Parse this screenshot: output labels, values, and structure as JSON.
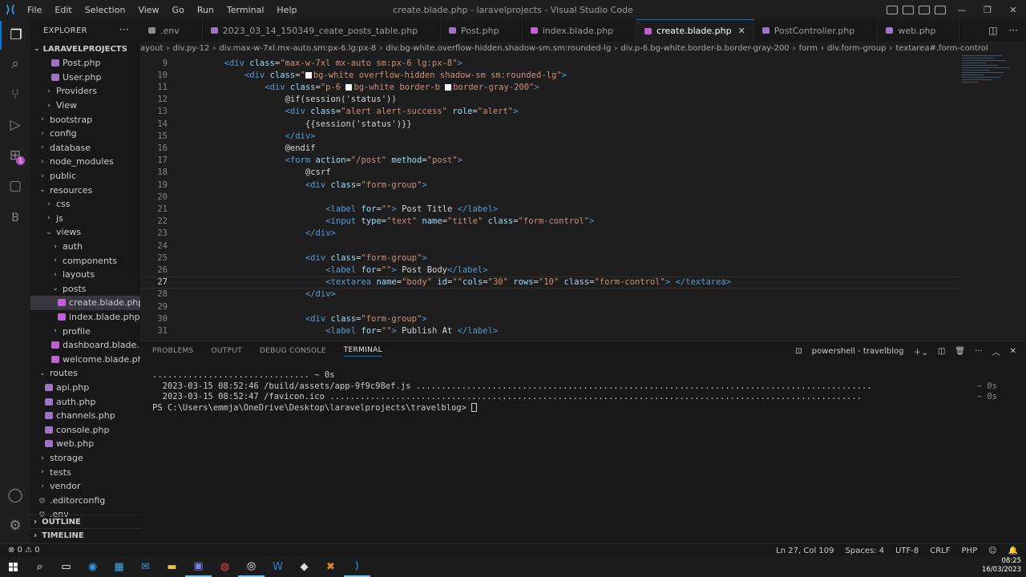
{
  "titlebar": {
    "menu": [
      "File",
      "Edit",
      "Selection",
      "View",
      "Go",
      "Run",
      "Terminal",
      "Help"
    ],
    "title": "create.blade.php - laravelprojects - Visual Studio Code"
  },
  "sidebar": {
    "header": "EXPLORER",
    "project": "LARAVELPROJECTS",
    "items": [
      {
        "label": "Post.php",
        "kind": "php",
        "indent": 3
      },
      {
        "label": "User.php",
        "kind": "php",
        "indent": 3
      },
      {
        "label": "Providers",
        "kind": "folder",
        "indent": 2
      },
      {
        "label": "View",
        "kind": "folder",
        "indent": 2
      },
      {
        "label": "bootstrap",
        "kind": "folder",
        "indent": 1
      },
      {
        "label": "config",
        "kind": "folder",
        "indent": 1
      },
      {
        "label": "database",
        "kind": "folder",
        "indent": 1
      },
      {
        "label": "node_modules",
        "kind": "folder",
        "indent": 1
      },
      {
        "label": "public",
        "kind": "folder",
        "indent": 1
      },
      {
        "label": "resources",
        "kind": "folder-open",
        "indent": 1
      },
      {
        "label": "css",
        "kind": "folder",
        "indent": 2
      },
      {
        "label": "js",
        "kind": "folder",
        "indent": 2
      },
      {
        "label": "views",
        "kind": "folder-open",
        "indent": 2
      },
      {
        "label": "auth",
        "kind": "folder",
        "indent": 3
      },
      {
        "label": "components",
        "kind": "folder",
        "indent": 3
      },
      {
        "label": "layouts",
        "kind": "folder",
        "indent": 3
      },
      {
        "label": "posts",
        "kind": "folder-open",
        "indent": 3
      },
      {
        "label": "create.blade.php",
        "kind": "blade",
        "indent": 4,
        "selected": true
      },
      {
        "label": "index.blade.php",
        "kind": "blade",
        "indent": 4
      },
      {
        "label": "profile",
        "kind": "folder",
        "indent": 3
      },
      {
        "label": "dashboard.blade....",
        "kind": "blade",
        "indent": 3
      },
      {
        "label": "welcome.blade.php",
        "kind": "blade",
        "indent": 3
      },
      {
        "label": "routes",
        "kind": "folder-open",
        "indent": 1
      },
      {
        "label": "api.php",
        "kind": "php",
        "indent": 2
      },
      {
        "label": "auth.php",
        "kind": "php",
        "indent": 2
      },
      {
        "label": "channels.php",
        "kind": "php",
        "indent": 2
      },
      {
        "label": "console.php",
        "kind": "php",
        "indent": 2
      },
      {
        "label": "web.php",
        "kind": "php",
        "indent": 2
      },
      {
        "label": "storage",
        "kind": "folder",
        "indent": 1
      },
      {
        "label": "tests",
        "kind": "folder",
        "indent": 1
      },
      {
        "label": "vendor",
        "kind": "folder",
        "indent": 1
      },
      {
        "label": ".editorconfig",
        "kind": "gear",
        "indent": 1
      },
      {
        "label": ".env",
        "kind": "gear",
        "indent": 1
      }
    ],
    "outline": "OUTLINE",
    "timeline": "TIMELINE"
  },
  "tabs": [
    {
      "label": ".env",
      "color": "#8c8c8c"
    },
    {
      "label": "2023_03_14_150349_ceate_posts_table.php",
      "color": "#a074c4"
    },
    {
      "label": "Post.php",
      "color": "#a074c4"
    },
    {
      "label": "index.blade.php",
      "color": "#c25fd6"
    },
    {
      "label": "create.blade.php",
      "color": "#c25fd6",
      "active": true
    },
    {
      "label": "PostController.php",
      "color": "#a074c4"
    },
    {
      "label": "web.php",
      "color": "#a074c4"
    }
  ],
  "breadcrumb": [
    "ayout",
    "div.py-12",
    "div.max-w-7xl.mx-auto.sm:px-6.lg:px-8",
    "div.bg-white.overflow-hidden.shadow-sm.sm:rounded-lg",
    "div.p-6.bg-white.border-b.border-gray-200",
    "form",
    "div.form-group",
    "textarea#.form-control"
  ],
  "editor": {
    "lines": [
      {
        "n": "9",
        "indent": 4,
        "html": "<span class='tag'>&lt;div</span> <span class='attr'>class</span>=<span class='str'>\"max-w-7xl mx-auto sm:px-6 lg:px-8\"</span><span class='tag'>&gt;</span>"
      },
      {
        "n": "10",
        "indent": 6,
        "html": "<span class='tag'>&lt;div</span> <span class='attr'>class</span>=<span class='str'>\"<i class='sq'></i>bg-white overflow-hidden shadow-sm sm:rounded-lg\"</span><span class='tag'>&gt;</span>"
      },
      {
        "n": "11",
        "indent": 8,
        "html": "<span class='tag'>&lt;div</span> <span class='attr'>class</span>=<span class='str'>\"p-6 <i class='sq'></i>bg-white border-b <i class='sq'></i>border-gray-200\"</span><span class='tag'>&gt;</span>"
      },
      {
        "n": "12",
        "indent": 10,
        "html": "<span class='dir'>@if(session('status'))</span>"
      },
      {
        "n": "13",
        "indent": 10,
        "html": "<span class='tag'>&lt;div</span> <span class='attr'>class</span>=<span class='str'>\"alert alert-success\"</span> <span class='attr'>role</span>=<span class='str'>\"alert\"</span><span class='tag'>&gt;</span>"
      },
      {
        "n": "14",
        "indent": 12,
        "html": "<span class='dir'>{{session('status')}}</span>"
      },
      {
        "n": "15",
        "indent": 10,
        "html": "<span class='tag'>&lt;/div&gt;</span>"
      },
      {
        "n": "16",
        "indent": 10,
        "html": "<span class='dir'>@endif</span>"
      },
      {
        "n": "17",
        "indent": 10,
        "html": "<span class='tag'>&lt;form</span> <span class='attr'>action</span>=<span class='str'>\"/post\"</span> <span class='attr'>method</span>=<span class='str'>\"post\"</span><span class='tag'>&gt;</span>"
      },
      {
        "n": "18",
        "indent": 12,
        "html": "<span class='dir'>@csrf</span>"
      },
      {
        "n": "19",
        "indent": 12,
        "html": "<span class='tag'>&lt;div</span> <span class='attr'>class</span>=<span class='str'>\"form-group\"</span><span class='tag'>&gt;</span>"
      },
      {
        "n": "20",
        "indent": 0,
        "html": ""
      },
      {
        "n": "21",
        "indent": 14,
        "html": "<span class='tag'>&lt;label</span> <span class='attr'>for</span>=<span class='str'>\"\"</span><span class='tag'>&gt;</span> Post Title <span class='tag'>&lt;/label&gt;</span>"
      },
      {
        "n": "22",
        "indent": 14,
        "html": "<span class='tag'>&lt;input</span> <span class='attr'>type</span>=<span class='str'>\"text\"</span> <span class='attr'>name</span>=<span class='str'>\"title\"</span> <span class='attr'>class</span>=<span class='str'>\"form-control\"</span><span class='tag'>&gt;</span>"
      },
      {
        "n": "23",
        "indent": 12,
        "html": "<span class='tag'>&lt;/div&gt;</span>"
      },
      {
        "n": "24",
        "indent": 0,
        "html": ""
      },
      {
        "n": "25",
        "indent": 12,
        "html": "<span class='tag'>&lt;div</span> <span class='attr'>class</span>=<span class='str'>\"form-group\"</span><span class='tag'>&gt;</span>"
      },
      {
        "n": "26",
        "indent": 14,
        "html": "<span class='tag'>&lt;label</span> <span class='attr'>for</span>=<span class='str'>\"\"</span><span class='tag'>&gt;</span> Post Body<span class='tag'>&lt;/label&gt;</span>"
      },
      {
        "n": "27",
        "indent": 14,
        "current": true,
        "html": "<span class='tag'>&lt;textarea</span> <span class='attr'>name</span>=<span class='str'>\"body\"</span> <span class='attr'>id</span>=<span class='str'>\"\"</span><span class='attr'>cols</span>=<span class='str'>\"30\"</span> <span class='attr'>rows</span>=<span class='str'>\"10\"</span> <span class='attr'>class</span>=<span class='str'>\"form-control\"</span><span class='tag'>&gt;</span> <span class='tag'>&lt;/textarea&gt;</span>"
      },
      {
        "n": "28",
        "indent": 12,
        "html": "<span class='tag'>&lt;/div&gt;</span>"
      },
      {
        "n": "29",
        "indent": 0,
        "html": ""
      },
      {
        "n": "30",
        "indent": 12,
        "html": "<span class='tag'>&lt;div</span> <span class='attr'>class</span>=<span class='str'>\"form-group\"</span><span class='tag'>&gt;</span>"
      },
      {
        "n": "31",
        "indent": 14,
        "html": "<span class='tag'>&lt;label</span> <span class='attr'>for</span>=<span class='str'>\"\"</span><span class='tag'>&gt;</span> Publish At <span class='tag'>&lt;/label&gt;</span>"
      }
    ]
  },
  "panel": {
    "tabs": [
      "PROBLEMS",
      "OUTPUT",
      "DEBUG CONSOLE",
      "TERMINAL"
    ],
    "active_tab": "TERMINAL",
    "shell": "powershell - travelblog",
    "terminal": [
      {
        "text": "............................... ~ 0s",
        "right": ""
      },
      {
        "text": "  2023-03-15 08:52:46 /build/assets/app-9f9c98ef.js ..........................................................................................",
        "right": "~ 0s"
      },
      {
        "text": "  2023-03-15 08:52:47 /favicon.ico .........................................................................................................",
        "right": "~ 0s"
      },
      {
        "text": "PS C:\\Users\\emmja\\OneDrive\\Desktop\\laravelprojects\\travelblog> ",
        "right": "",
        "cursor": true
      }
    ]
  },
  "statusbar": {
    "problems": "⊗ 0 ⚠ 0",
    "position": "Ln 27, Col 109",
    "spaces": "Spaces: 4",
    "encoding": "UTF-8",
    "eol": "CRLF",
    "language": "PHP"
  },
  "taskbar": {
    "time": "08:25",
    "date": "16/03/2023"
  }
}
